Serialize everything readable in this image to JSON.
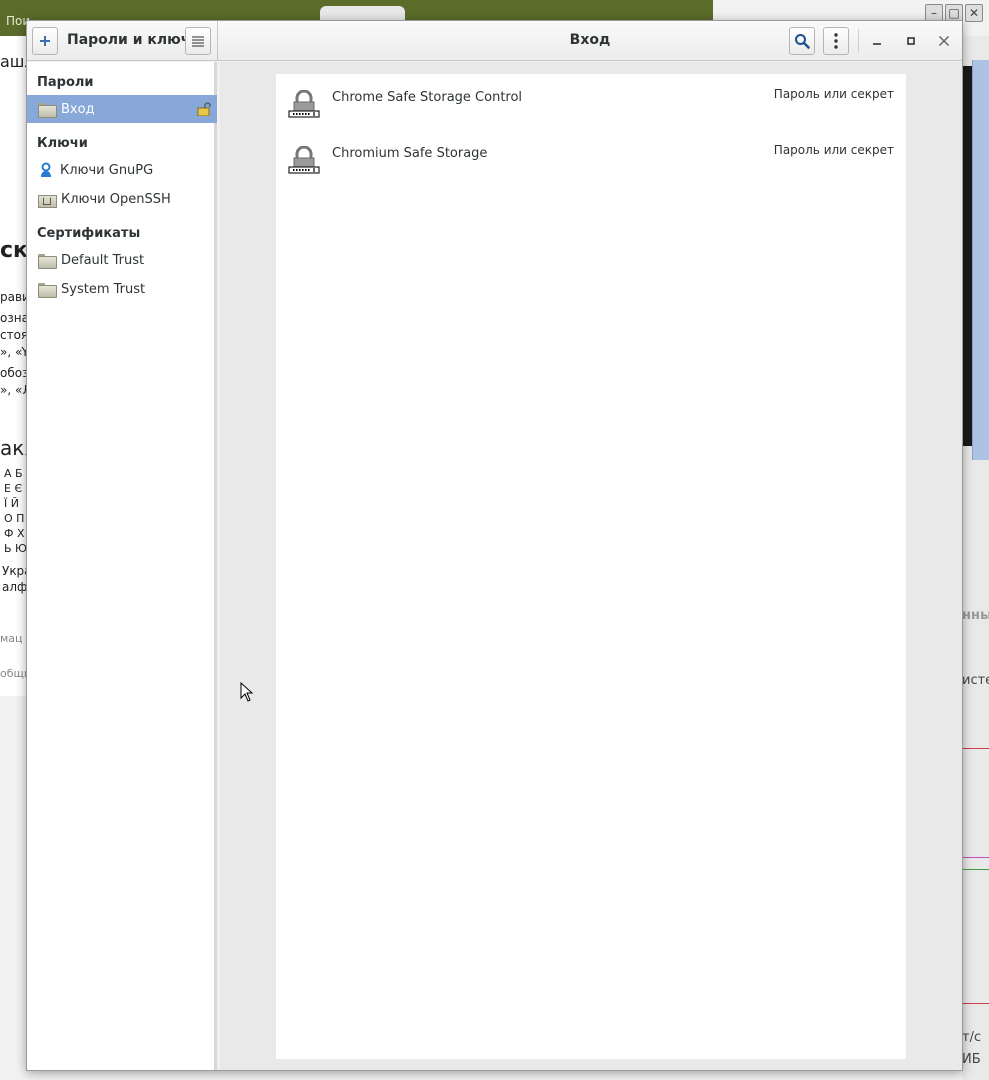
{
  "window": {
    "sidebar_title": "Пароли и ключи",
    "main_title": "Вход"
  },
  "sidebar": {
    "sections": [
      {
        "header": "Пароли",
        "items": [
          {
            "label": "Вход",
            "selected": true
          }
        ]
      },
      {
        "header": "Ключи",
        "items": [
          {
            "label": "Ключи GnuPG"
          },
          {
            "label": "Ключи OpenSSH"
          }
        ]
      },
      {
        "header": "Сертификаты",
        "items": [
          {
            "label": "Default Trust"
          },
          {
            "label": "System Trust"
          }
        ]
      }
    ]
  },
  "items": [
    {
      "name": "Chrome Safe Storage Control",
      "type": "Пароль или секрет"
    },
    {
      "name": "Chromium Safe Storage",
      "type": "Пароль или секрет"
    }
  ],
  "background": {
    "top_text": "Пои",
    "left_snippets": [
      "ашл",
      "ск",
      "рави",
      "озна",
      "стоя",
      "», «Y»",
      "обоз",
      "», «Л",
      "акж",
      "А Б",
      "Е Є",
      "Ї Й",
      "О П",
      "Ф Х",
      "Ь Ю",
      "Укра",
      "алф",
      "мац",
      "общи"
    ],
    "right_snippets": [
      "нный",
      "истем",
      "т/с",
      "ИБ"
    ]
  },
  "colors": {
    "selection": "#87a8d9",
    "accent_blue": "#3a6fb0"
  }
}
